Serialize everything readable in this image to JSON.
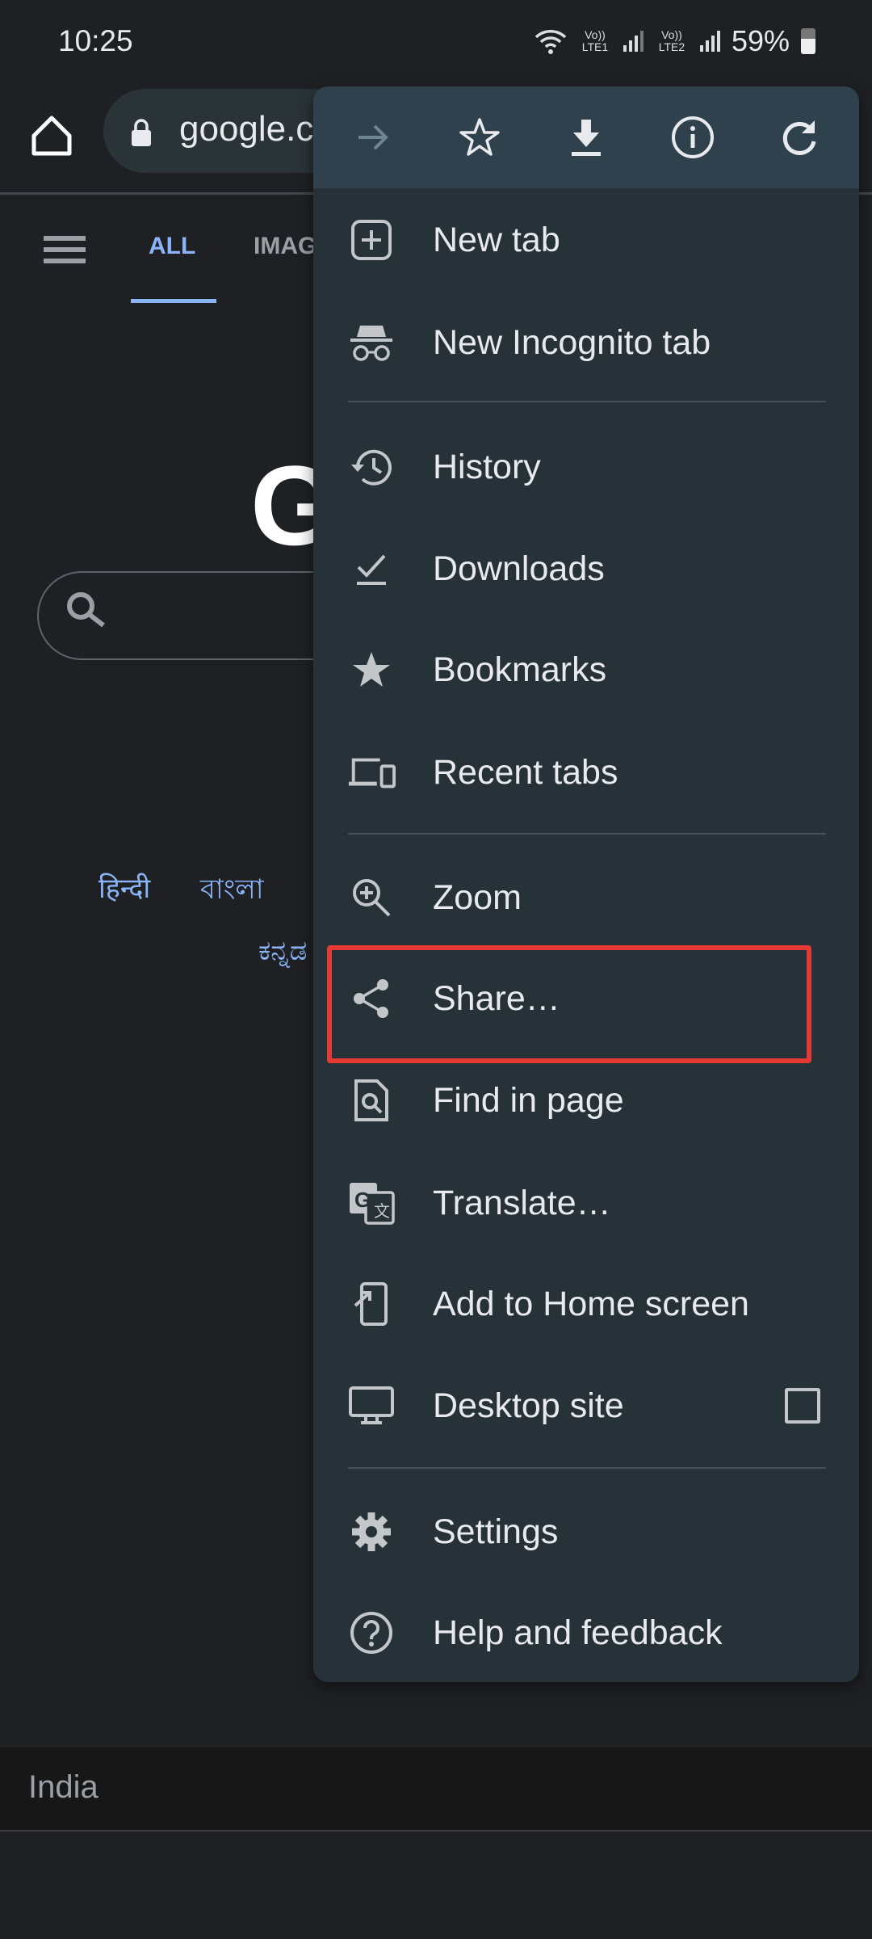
{
  "status_bar": {
    "time": "10:25",
    "sim1": "Vo)) LTE1",
    "sim2": "Vo)) LTE2",
    "battery": "59%"
  },
  "toolbar": {
    "url": "google.c"
  },
  "page": {
    "tabs": [
      {
        "label": "ALL",
        "active": true
      },
      {
        "label": "IMAG"
      }
    ],
    "logo": "G",
    "languages": [
      "हिन्दी",
      "বাংলা",
      "ಕನ್ನಡ"
    ],
    "footer_country": "India"
  },
  "menu": {
    "header_icons": [
      "forward-icon",
      "bookmark-star-icon",
      "download-icon",
      "info-icon",
      "reload-icon"
    ],
    "items": [
      {
        "label": "New tab",
        "icon": "new-tab-icon"
      },
      {
        "label": "New Incognito tab",
        "icon": "incognito-icon"
      },
      {
        "label": "History",
        "icon": "history-icon"
      },
      {
        "label": "Downloads",
        "icon": "downloads-icon"
      },
      {
        "label": "Bookmarks",
        "icon": "bookmarks-icon"
      },
      {
        "label": "Recent tabs",
        "icon": "recent-tabs-icon"
      },
      {
        "label": "Zoom",
        "icon": "zoom-icon"
      },
      {
        "label": "Share…",
        "icon": "share-icon"
      },
      {
        "label": "Find in page",
        "icon": "find-in-page-icon"
      },
      {
        "label": "Translate…",
        "icon": "translate-icon"
      },
      {
        "label": "Add to Home screen",
        "icon": "add-to-home-icon"
      },
      {
        "label": "Desktop site",
        "icon": "desktop-icon",
        "checked": false
      },
      {
        "label": "Settings",
        "icon": "settings-icon"
      },
      {
        "label": "Help and feedback",
        "icon": "help-icon"
      }
    ],
    "highlight_color": "#e53935"
  }
}
